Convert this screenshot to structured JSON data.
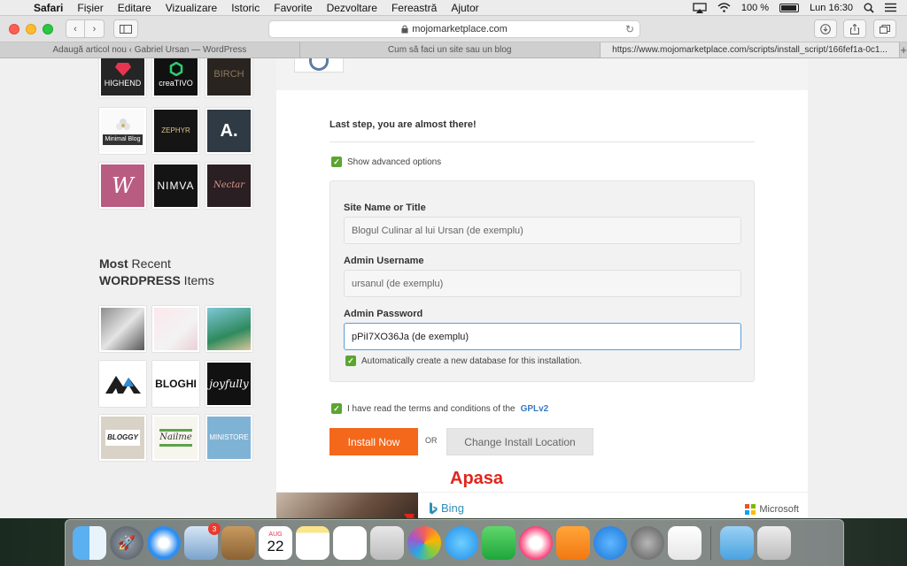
{
  "menubar": {
    "app": "Safari",
    "items": [
      "Fișier",
      "Editare",
      "Vizualizare",
      "Istoric",
      "Favorite",
      "Dezvoltare",
      "Fereastră",
      "Ajutor"
    ],
    "battery": "100 %",
    "clock": "Lun 16:30"
  },
  "toolbar": {
    "url": "mojomarketplace.com"
  },
  "tabs": [
    "Adaugă articol nou ‹ Gabriel Ursan — WordPress",
    "Cum să faci un site sau un blog",
    "https://www.mojomarketplace.com/scripts/install_script/166fef1a-0c1..."
  ],
  "sidebar": {
    "themes_top": [
      "HIGHEND",
      "creaTIVO",
      "BIRCH",
      "Minimal Blog",
      "ZEPHYR",
      "A.",
      "W",
      "NIMVA",
      "Nectar"
    ],
    "recent_title_1_bold": "Most",
    "recent_title_1_rest": " Recent",
    "recent_title_2_bold": "WORDPRESS",
    "recent_title_2_rest": " Items",
    "themes_recent": [
      "",
      "",
      "",
      "",
      "BLOGHI",
      "joyfully",
      "BLOGGY",
      "Nailme",
      "MINISTORE"
    ]
  },
  "install": {
    "step_title": "Last step, you are almost there!",
    "advanced_label": "Show advanced options",
    "site_name_label": "Site Name or Title",
    "site_name_value": "Blogul Culinar al lui Ursan (de exemplu)",
    "username_label": "Admin Username",
    "username_value": "ursanul (de exemplu)",
    "password_label": "Admin Password",
    "password_value": "pPiI7XO36Ja (de exemplu)",
    "auto_db_label": "Automatically create a new database for this installation.",
    "terms_label": "I have read the terms and conditions of the",
    "terms_link": "GPLv2",
    "install_button": "Install Now",
    "or_label": "OR",
    "change_button": "Change Install Location"
  },
  "annotation": "Apasa",
  "ads": {
    "bing": "Bing",
    "microsoft": "Microsoft"
  },
  "dock": {
    "mail_badge": "3",
    "calendar_month": "AUG",
    "calendar_day": "22"
  },
  "colors": {
    "install_button": "#f4681b",
    "checkbox": "#5ba530",
    "annotation": "#e0251c",
    "link": "#3b78c2"
  }
}
